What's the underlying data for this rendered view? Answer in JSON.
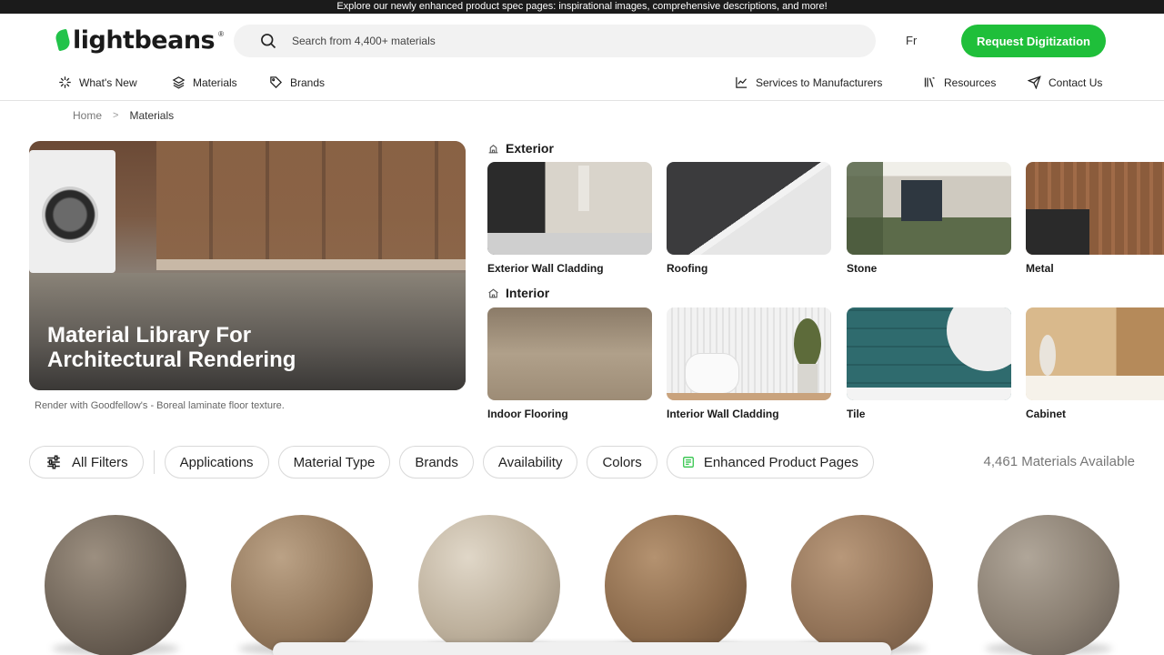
{
  "announcement": "Explore our newly enhanced product spec pages: inspirational images, comprehensive descriptions, and more!",
  "brand": {
    "name": "lightbeans",
    "mark": "®",
    "accent": "#1fbf3a"
  },
  "search": {
    "placeholder": "Search from 4,400+ materials"
  },
  "header": {
    "language": "Fr",
    "request_label": "Request Digitization"
  },
  "nav": {
    "left": [
      {
        "label": "What's New",
        "icon": "sparkle-icon"
      },
      {
        "label": "Materials",
        "icon": "layers-icon"
      },
      {
        "label": "Brands",
        "icon": "tag-icon"
      }
    ],
    "right": [
      {
        "label": "Services to Manufacturers",
        "icon": "chart-icon"
      },
      {
        "label": "Resources",
        "icon": "books-icon"
      },
      {
        "label": "Contact Us",
        "icon": "send-icon"
      }
    ]
  },
  "breadcrumb": {
    "home": "Home",
    "separator": ">",
    "current": "Materials"
  },
  "hero": {
    "title_line1": "Material Library For",
    "title_line2": "Architectural Rendering",
    "caption": "Render with Goodfellow's - Boreal laminate floor texture."
  },
  "categories": {
    "exterior": {
      "heading": "Exterior",
      "items": [
        {
          "label": "Exterior Wall Cladding"
        },
        {
          "label": "Roofing"
        },
        {
          "label": "Stone"
        },
        {
          "label": "Metal"
        }
      ]
    },
    "interior": {
      "heading": "Interior",
      "items": [
        {
          "label": "Indoor Flooring"
        },
        {
          "label": "Interior Wall Cladding"
        },
        {
          "label": "Tile"
        },
        {
          "label": "Cabinet"
        }
      ]
    }
  },
  "filters": {
    "all": "All Filters",
    "chips": [
      "Applications",
      "Material Type",
      "Brands",
      "Availability",
      "Colors"
    ],
    "enhanced": "Enhanced Product Pages",
    "count": "4,461 Materials Available"
  }
}
